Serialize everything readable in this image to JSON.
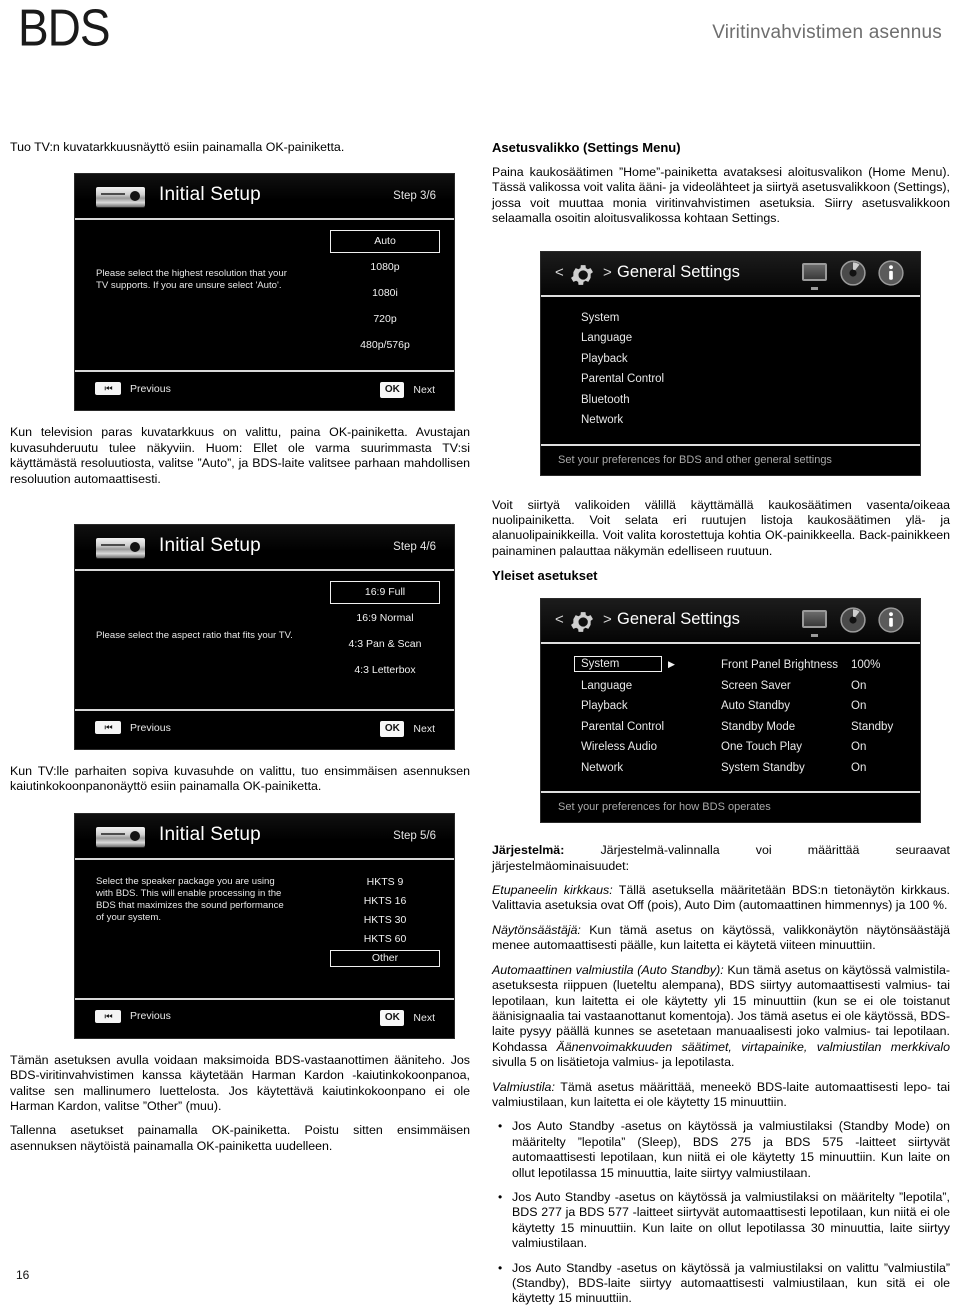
{
  "header": {
    "logo": "BDS",
    "title": "Viritinvahvistimen asennus"
  },
  "page_number": "16",
  "left_column": {
    "intro": "Tuo TV:n kuvatarkkuusnäyttö esiin painamalla OK-painiketta.",
    "after_step3": "Kun television paras kuvatarkkuus on valittu, paina OK-painiketta. Avustajan kuvasuhderuutu tulee näkyviin. Huom: Ellet ole varma suurimmasta TV:si käyttämästä resoluutiosta, valitse ”Auto”, ja BDS-laite valitsee parhaan mahdollisen resoluution automaattisesti.",
    "after_step4": "Kun TV:lle parhaiten sopiva kuvasuhde on valittu, tuo ensimmäisen asennuksen kaiutinkokoonpanonäyttö esiin painamalla OK-painiketta.",
    "after_step5_p1": "Tämän asetuksen avulla voidaan maksimoida BDS-vastaanottimen ääniteho. Jos BDS-viritinvahvistimen kanssa käytetään Harman Kardon -kaiutinkokoonpanoa, valitse sen mallinumero luettelosta. Jos käytettävä kaiutinkokoonpano ei ole Harman Kardon, valitse ”Other” (muu).",
    "after_step5_p2": "Tallenna asetukset painamalla OK-painiketta. Poistu sitten ensimmäisen asennuksen näytöistä painamalla OK-painiketta uudelleen."
  },
  "screens": {
    "step3": {
      "title": "Initial Setup",
      "step": "Step 3/6",
      "description": "Please select the highest resolution that your TV supports. If you are unsure select 'Auto'.",
      "options": [
        "Auto",
        "1080p",
        "1080i",
        "720p",
        "480p/576p"
      ],
      "selected": "Auto",
      "previous_label": "Previous",
      "ok_label": "OK",
      "next_label": "Next",
      "prev_icon": "skip-back-icon",
      "device_icon": "bd-player-icon"
    },
    "step4": {
      "title": "Initial Setup",
      "step": "Step 4/6",
      "description": "Please select the aspect ratio that fits your TV.",
      "options": [
        "16:9 Full",
        "16:9 Normal",
        "4:3 Pan & Scan",
        "4:3 Letterbox"
      ],
      "selected": "16:9 Full",
      "previous_label": "Previous",
      "ok_label": "OK",
      "next_label": "Next"
    },
    "step5": {
      "title": "Initial Setup",
      "step": "Step 5/6",
      "description": "Select the speaker package you are using with BDS. This will enable processing in the BDS that maximizes the sound performance of your system.",
      "options": [
        "HKTS 9",
        "HKTS 16",
        "HKTS 30",
        "HKTS 60",
        "Other"
      ],
      "selected": "Other",
      "previous_label": "Previous",
      "ok_label": "OK",
      "next_label": "Next"
    }
  },
  "settings_panels": {
    "panel1": {
      "title": "General Settings",
      "left_chevron": "<",
      "right_chevron": ">",
      "menu": [
        "System",
        "Language",
        "Playback",
        "Parental Control",
        "Bluetooth",
        "Network"
      ],
      "footer": "Set your preferences for BDS and other general settings",
      "icons": [
        "gear-icon",
        "tv-icon",
        "disc-icon",
        "info-icon"
      ]
    },
    "panel2": {
      "title": "General Settings",
      "left_chevron": "<",
      "right_chevron": ">",
      "menu": [
        "System",
        "Language",
        "Playback",
        "Parental Control",
        "Wireless Audio",
        "Network"
      ],
      "selected_menu": "System",
      "settings": [
        {
          "name": "Front Panel Brightness",
          "value": "100%"
        },
        {
          "name": "Screen Saver",
          "value": "On"
        },
        {
          "name": "Auto Standby",
          "value": "On"
        },
        {
          "name": "Standby Mode",
          "value": "Standby"
        },
        {
          "name": "One Touch Play",
          "value": "On"
        },
        {
          "name": "System Standby",
          "value": "On"
        }
      ],
      "footer": "Set your preferences for how BDS operates",
      "icons": [
        "gear-icon",
        "tv-icon",
        "disc-icon",
        "info-icon"
      ]
    }
  },
  "right_column": {
    "settings_menu_heading": "Asetusvalikko (Settings Menu)",
    "settings_menu_text": "Paina kaukosäätimen ”Home”-painiketta avataksesi aloitusvalikon (Home Menu). Tässä valikossa voit valita ääni- ja videolähteet ja siirtyä asetusvalikkoon (Settings), jossa voit muuttaa monia viritinvahvistimen asetuksia. Siirry asetusvalikkoon selaamalla osoitin aloitusvalikossa kohtaan Settings.",
    "navigation_text": "Voit siirtyä valikoiden välillä käyttämällä kaukosäätimen vasenta/oikeaa nuolipainiketta. Voit selata eri ruutujen listoja kaukosäätimen ylä- ja alanuolipainikkeilla. Voit valita korostettuja kohtia OK-painikkeella. Back-painikkeen painaminen palauttaa näkymän edelliseen ruutuun.",
    "general_settings_heading": "Yleiset asetukset",
    "system_label": "Järjestelmä:",
    "system_text": " Järjestelmä-valinnalla voi määrittää seuraavat järjestelmäominaisuudet:",
    "front_panel_label": "Etupaneelin kirkkaus:",
    "front_panel_text": " Tällä asetuksella määritetään BDS:n tietonäytön kirkkaus. Valittavia asetuksia ovat Off (pois), Auto Dim (automaattinen himmennys) ja 100 %.",
    "screensaver_label": "Näytönsäästäjä:",
    "screensaver_text": " Kun tämä asetus on käytössä, valikkonäytön näytönsäästäjä menee automaattisesti päälle, kun laitetta ei käytetä viiteen minuuttiin.",
    "autostandby_label": "Automaattinen valmiustila (Auto Standby):",
    "autostandby_text_a": " Kun tämä asetus on käytössä valmistila-asetuksesta riippuen (lueteltu alempana), BDS siirtyy automaattisesti valmius- tai lepotilaan, kun laitetta ei ole käytetty yli 15 minuuttiin (kun se ei ole toistanut äänisignaalia tai vastaanottanut komentoja). Jos tämä asetus ei ole käytössä, BDS-laite pysyy päällä kunnes se asetetaan manuaalisesti joko valmius- tai lepotilaan. Kohdassa ",
    "autostandby_italic_ref": "Äänenvoimakkuuden säätimet, virtapainike, valmiustilan merkkivalo",
    "autostandby_text_b": " sivulla 5 on lisätietoja valmius- ja lepotilasta.",
    "valmiustila_label": "Valmiustila:",
    "valmiustila_text": " Tämä asetus määrittää, meneekö BDS-laite automaattisesti lepo- tai valmiustilaan, kun laitetta ei ole käytetty 15 minuuttiin.",
    "bullets": [
      "Jos Auto Standby -asetus on käytössä ja valmiustilaksi (Standby Mode) on määritelty ”lepotila” (Sleep), BDS 275 ja BDS 575 -laitteet siirtyvät automaattisesti lepotilaan, kun niitä ei ole käytetty 15 minuuttiin. Kun laite on ollut lepotilassa 15 minuuttia, laite siirtyy valmiustilaan.",
      "Jos Auto Standby -asetus on käytössä ja valmiustilaksi on määritelty ”lepotila”, BDS 277 ja BDS 577 -laitteet siirtyvät automaattisesti lepotilaan, kun niitä ei ole käytetty 15 minuuttiin. Kun laite on ollut lepotilassa 30 minuuttia, laite siirtyy valmiustilaan.",
      "Jos Auto Standby -asetus on käytössä ja valmiustilaksi on valittu ”valmiustila” (Standby), BDS-laite siirtyy automaattisesti valmiustilaan, kun sitä ei ole käytetty 15 minuuttiin."
    ]
  }
}
